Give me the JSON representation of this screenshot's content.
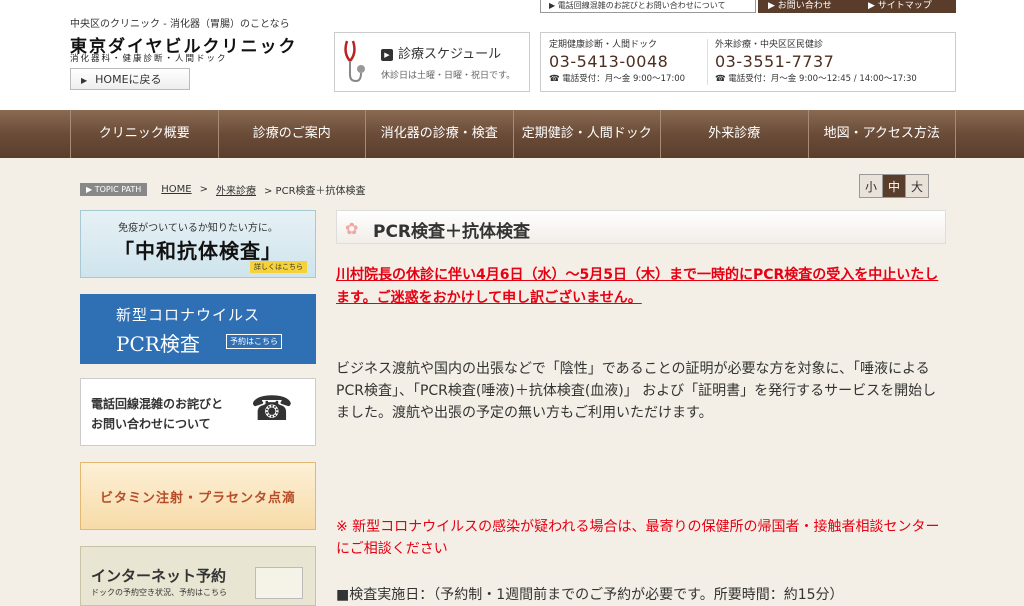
{
  "header": {
    "tagline": "中央区のクリニック - 消化器（胃腸）のことなら",
    "logo_main": "東京ダイヤビルクリニック",
    "logo_sub": "消化器科・健康診断・人間ドック",
    "home_button": "HOMEに戻る",
    "topbar": {
      "link1": "▶ 電話回線混雑のお詫びとお問い合わせについて",
      "link2": "▶ お問い合わせ",
      "link3": "▶ サイトマップ"
    },
    "schedule": {
      "title": "診療スケジュール",
      "note": "休診日は土曜・日曜・祝日です。"
    },
    "phones": [
      {
        "label": "定期健康診断・人間ドック",
        "number": "03-5413-0048",
        "hours": "☎ 電話受付：月～金 9:00～17:00"
      },
      {
        "label": "外来診療・中央区区民健診",
        "number": "03-3551-7737",
        "hours": "☎ 電話受付：月～金 9:00～12:45 / 14:00～17:30"
      }
    ]
  },
  "nav": [
    "クリニック概要",
    "診療のご案内",
    "消化器の診療・検査",
    "定期健診・人間ドック",
    "外来診療",
    "地図・アクセス方法"
  ],
  "breadcrumb": {
    "tag": "▶ TOPIC PATH",
    "home": "HOME",
    "sep": ">",
    "level1": "外来診療",
    "current": "> PCR検査＋抗体検査"
  },
  "fontsize": [
    "小",
    "中",
    "大"
  ],
  "sidebar": {
    "b1_line1": "免疫がついているか知りたい方に。",
    "b1_line2": "「中和抗体検査」",
    "b1_more": "詳しくはこちら",
    "b2_line1": "新型コロナウイルス",
    "b2_line2": "PCR検査",
    "b2_more": "予約はこちら",
    "b3_line1": "電話回線混雑のお詫びと",
    "b3_line2": "お問い合わせについて",
    "b4_line1": "ビタミン注射・プラセンタ点滴",
    "b5_line1": "インターネット予約",
    "b5_line2": "ドックの予約空き状況、予約はこちら"
  },
  "content": {
    "title": "PCR検査＋抗体検査",
    "notice": "川村院長の休診に伴い4月6日（水）～5月5日（木）まで一時的にPCR検査の受入を中止いたします。ご迷惑をおかけして申し訳ございません。",
    "body": "ビジネス渡航や国内の出張などで「陰性」であることの証明が必要な方を対象に、「唾液によるPCR検査」、「PCR検査(唾液)＋抗体検査(血液)」 および「証明書」を発行するサービスを開始しました。渡航や出張の予定の無い方もご利用いただけます。",
    "warning": "※ 新型コロナウイルスの感染が疑われる場合は、最寄りの保健所の帰国者・接触者相談センターにご相談ください",
    "cut_line": "■検査実施日：（予約制・1週間前までのご予約が必要です。所要時間：約15分）"
  }
}
